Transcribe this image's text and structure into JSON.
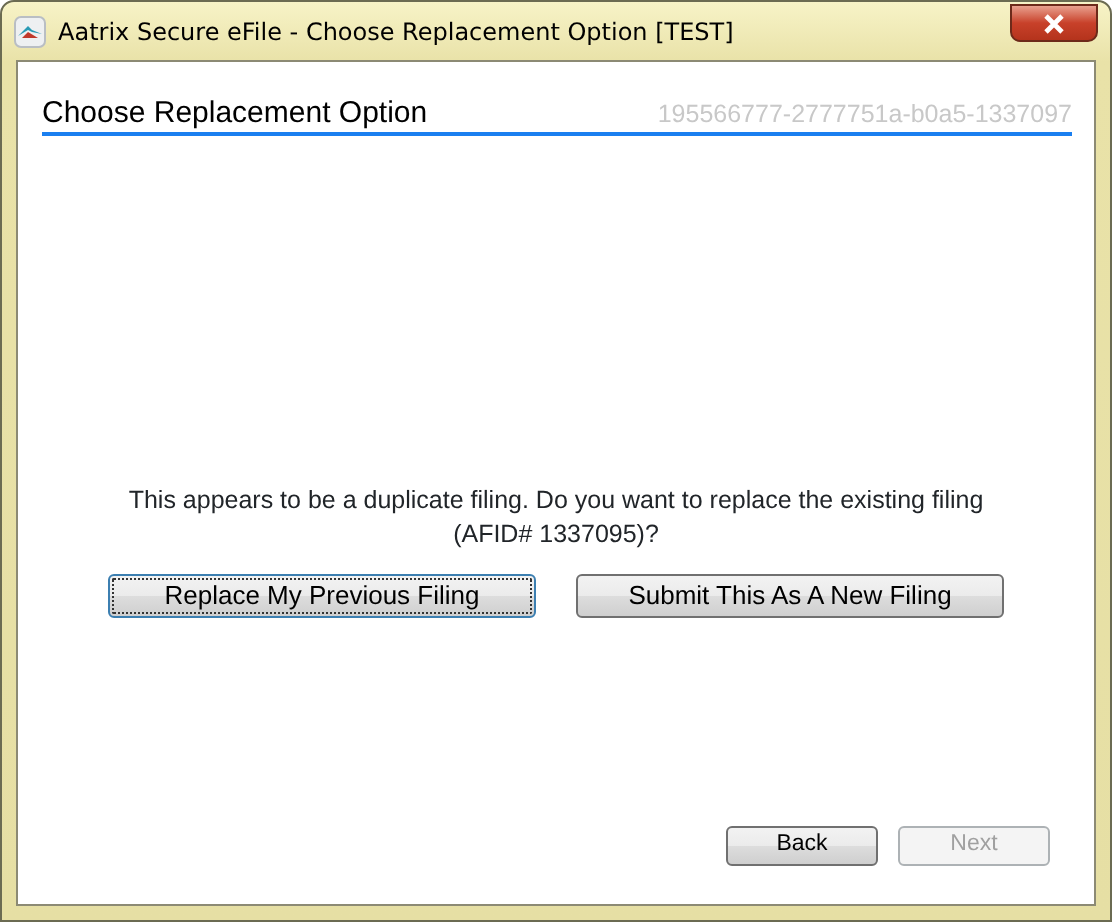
{
  "window": {
    "title": "Aatrix Secure eFile - Choose Replacement Option [TEST]"
  },
  "header": {
    "title": "Choose Replacement Option",
    "reference": "195566777-2777751a-b0a5-1337097"
  },
  "message": "This appears to be a duplicate filing. Do you want to replace the existing filing (AFID# 1337095)?",
  "choices": [
    {
      "label": "Replace My Previous Filing",
      "focused": true
    },
    {
      "label": "Submit This As A New Filing",
      "focused": false
    }
  ],
  "navigation": [
    {
      "label": "Back",
      "disabled": false
    },
    {
      "label": "Next",
      "disabled": true
    }
  ]
}
